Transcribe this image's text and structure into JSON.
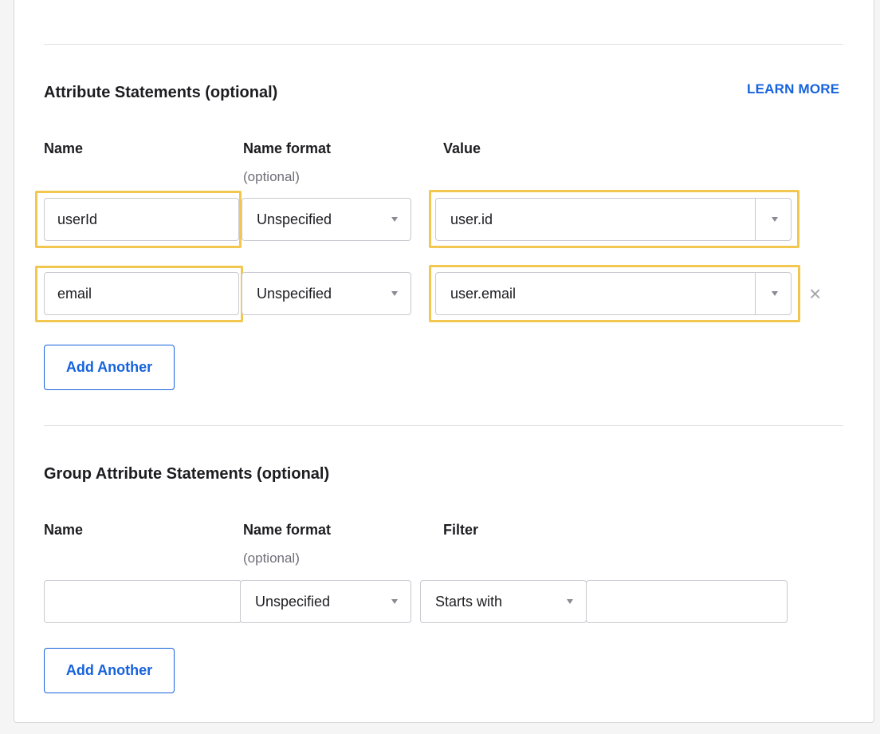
{
  "attribute_statements": {
    "title": "Attribute Statements (optional)",
    "learn_more": "LEARN MORE",
    "headers": {
      "name": "Name",
      "name_format": "Name format",
      "name_format_sub": "(optional)",
      "value": "Value"
    },
    "rows": [
      {
        "name": "userId",
        "name_format": "Unspecified",
        "value": "user.id"
      },
      {
        "name": "email",
        "name_format": "Unspecified",
        "value": "user.email"
      }
    ],
    "remove_icon": "×",
    "add_button": "Add Another"
  },
  "group_attribute_statements": {
    "title": "Group Attribute Statements (optional)",
    "headers": {
      "name": "Name",
      "name_format": "Name format",
      "name_format_sub": "(optional)",
      "filter": "Filter"
    },
    "row": {
      "name": "",
      "name_format": "Unspecified",
      "filter_type": "Starts with",
      "filter_value": ""
    },
    "add_button": "Add Another"
  },
  "colors": {
    "accent": "#1662dd",
    "highlight": "#f2c750"
  }
}
